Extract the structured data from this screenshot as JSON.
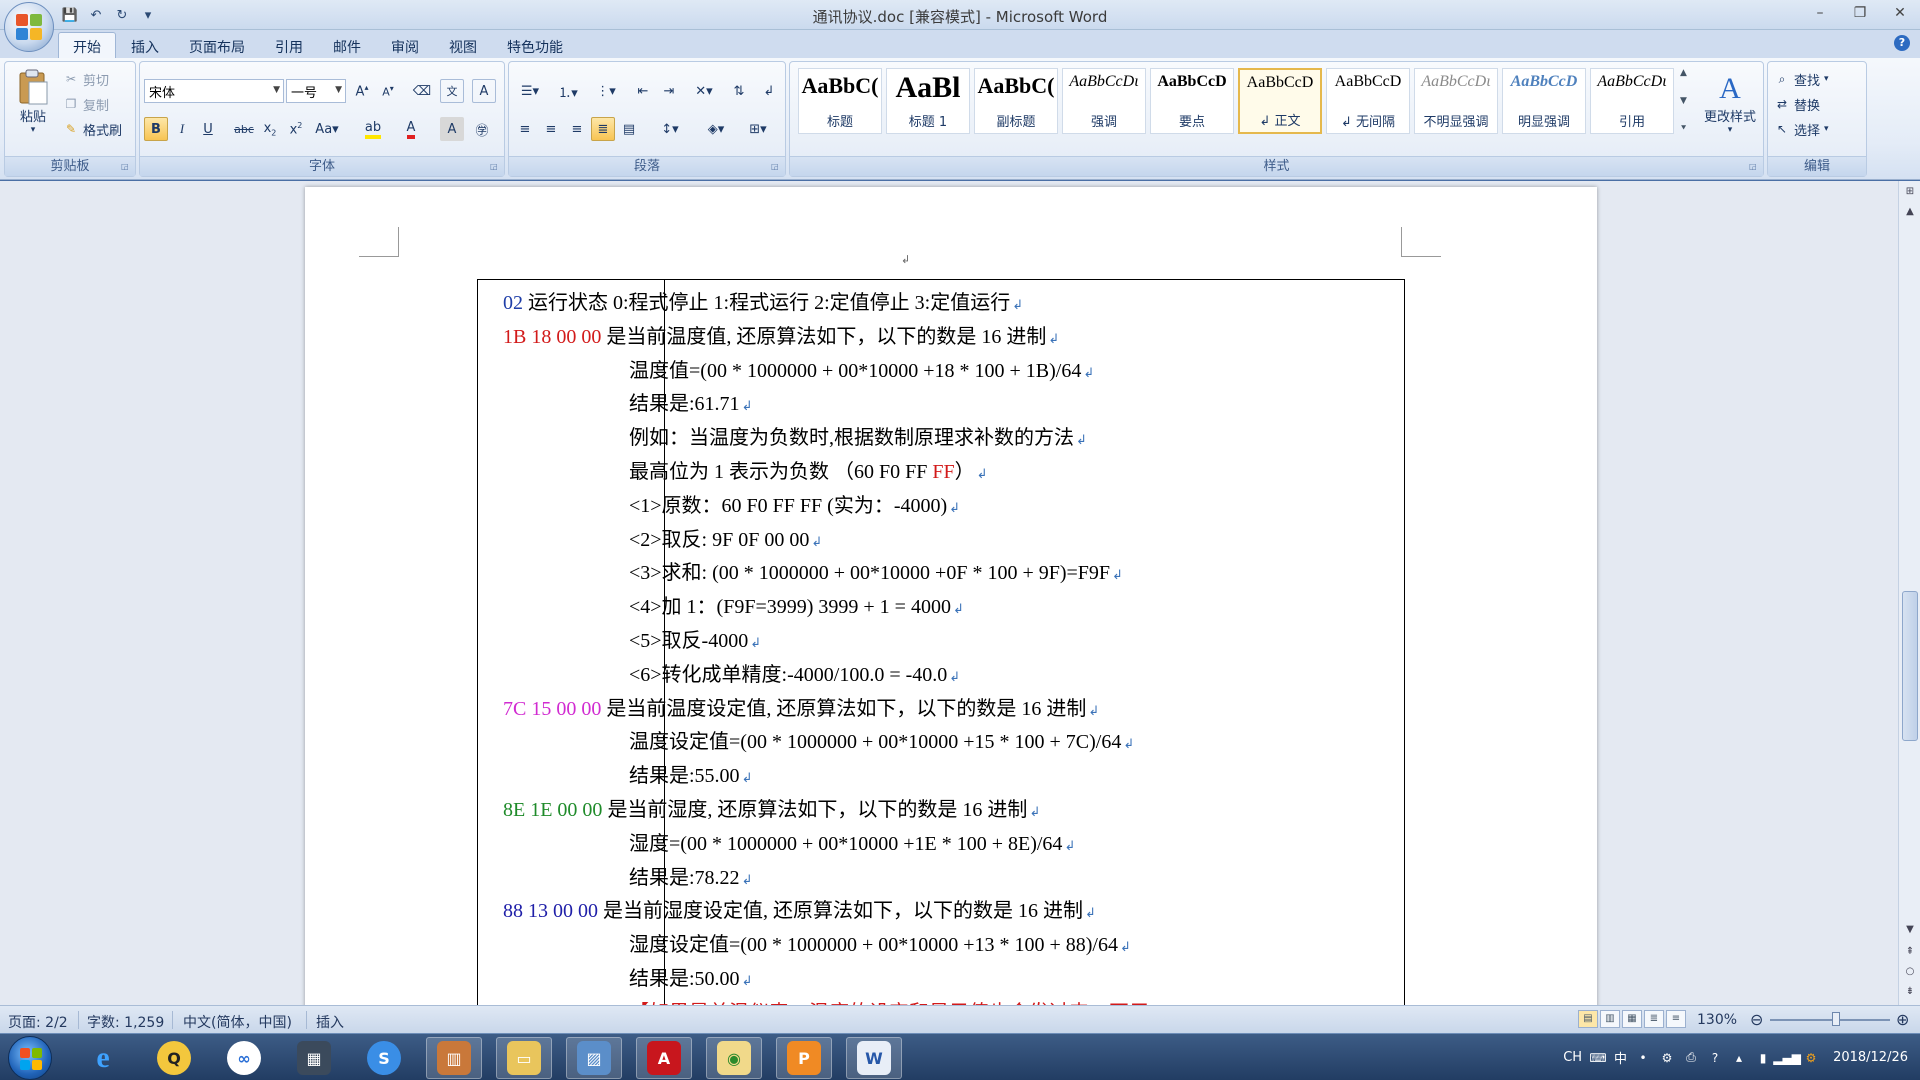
{
  "window": {
    "title": "通讯协议.doc [兼容模式] - Microsoft Word",
    "minimize": "–",
    "restore": "❐",
    "close": "✕"
  },
  "qat": {
    "save": "💾",
    "undo": "↶",
    "redo": "↻",
    "more": "▾"
  },
  "tabs": [
    "开始",
    "插入",
    "页面布局",
    "引用",
    "邮件",
    "审阅",
    "视图",
    "特色功能"
  ],
  "ribbon": {
    "clipboard": {
      "label": "剪贴板",
      "paste": "粘贴",
      "cut": "剪切",
      "copy": "复制",
      "format_painter": "格式刷"
    },
    "font": {
      "label": "字体",
      "font_name": "宋体",
      "font_size": "一号"
    },
    "paragraph": {
      "label": "段落"
    },
    "styles": {
      "label": "样式",
      "items": [
        {
          "sample": "AaBbC(",
          "name": "标题"
        },
        {
          "sample": "AaBl",
          "name": "标题 1"
        },
        {
          "sample": "AaBbC(",
          "name": "副标题"
        },
        {
          "sample": "AaBbCcDι",
          "name": "强调"
        },
        {
          "sample": "AaBbCcD",
          "name": "要点"
        },
        {
          "sample": "AaBbCcD",
          "name": "↲ 正文"
        },
        {
          "sample": "AaBbCcD",
          "name": "↲ 无间隔"
        },
        {
          "sample": "AaBbCcDι",
          "name": "不明显强调"
        },
        {
          "sample": "AaBbCcD",
          "name": "明显强调"
        },
        {
          "sample": "AaBbCcDι",
          "name": "引用"
        }
      ],
      "change_styles": "更改样式"
    },
    "editing": {
      "label": "编辑",
      "find": "查找",
      "replace": "替换",
      "select": "选择"
    }
  },
  "doc": {
    "lines": [
      {
        "parts": [
          {
            "t": "02 ",
            "c": "c-blue"
          },
          {
            "t": "运行状态 0:程式停止 1:程式运行 2:定值停止 3:定值运行"
          }
        ],
        "sub": false
      },
      {
        "parts": [
          {
            "t": "1B 18 00 00",
            "c": "c-red"
          },
          {
            "t": "  是当前温度值, 还原算法如下，以下的数是 16 进制"
          }
        ],
        "sub": false
      },
      {
        "parts": [
          {
            "t": "温度值=(00 * 1000000 + 00*10000 +18 * 100 + 1B)/64"
          }
        ],
        "sub": true
      },
      {
        "parts": [
          {
            "t": "结果是:61.71"
          }
        ],
        "sub": true
      },
      {
        "parts": [
          {
            "t": "例如：当温度为负数时,根据数制原理求补数的方法"
          }
        ],
        "sub": true
      },
      {
        "parts": [
          {
            "t": "最高位为 1 表示为负数 （60 F0 FF "
          },
          {
            "t": "FF",
            "c": "c-red"
          },
          {
            "t": "）"
          }
        ],
        "sub": true
      },
      {
        "parts": [
          {
            "t": "<1>原数：60 F0 FF FF        (实为：-4000)"
          }
        ],
        "sub": true
      },
      {
        "parts": [
          {
            "t": "<2>取反: 9F 0F 00 00"
          }
        ],
        "sub": true
      },
      {
        "parts": [
          {
            "t": "<3>求和: (00 * 1000000 + 00*10000 +0F * 100 + 9F)=F9F"
          }
        ],
        "sub": true
      },
      {
        "parts": [
          {
            "t": "<4>加 1：(F9F=3999)   3999 + 1 = 4000"
          }
        ],
        "sub": true
      },
      {
        "parts": [
          {
            "t": "<5>取反-4000"
          }
        ],
        "sub": true
      },
      {
        "parts": [
          {
            "t": "<6>转化成单精度:-4000/100.0   = -40.0"
          }
        ],
        "sub": true
      },
      {
        "parts": [
          {
            "t": "7C 15 00 00",
            "c": "c-mag"
          },
          {
            "t": "  是当前温度设定值, 还原算法如下，以下的数是 16 进制"
          }
        ],
        "sub": false
      },
      {
        "parts": [
          {
            "t": "温度设定值=(00 * 1000000 + 00*10000 +15 * 100 + 7C)/64"
          }
        ],
        "sub": true
      },
      {
        "parts": [
          {
            "t": "结果是:55.00"
          }
        ],
        "sub": true
      },
      {
        "parts": [
          {
            "t": "8E 1E 00 00",
            "c": "c-green"
          },
          {
            "t": "  是当前湿度, 还原算法如下，以下的数是 16 进制"
          }
        ],
        "sub": false
      },
      {
        "parts": [
          {
            "t": "湿度=(00 * 1000000 + 00*10000 +1E * 100 + 8E)/64"
          }
        ],
        "sub": true
      },
      {
        "parts": [
          {
            "t": "结果是:78.22"
          }
        ],
        "sub": true
      },
      {
        "parts": [
          {
            "t": "88 13 00 00",
            "c": "c-navy"
          },
          {
            "t": "  是当前湿度设定值, 还原算法如下，以下的数是 16 进制"
          }
        ],
        "sub": false
      },
      {
        "parts": [
          {
            "t": "湿度设定值=(00 * 1000000 + 00*10000 +13 * 100 + 88)/64"
          }
        ],
        "sub": true
      },
      {
        "parts": [
          {
            "t": "结果是:50.00"
          }
        ],
        "sub": true
      },
      {
        "parts": [
          {
            "t": "【如果是单温仪表，温度的设定和显示值也会发过来，不用",
            "c": "c-red"
          }
        ],
        "sub": true
      }
    ]
  },
  "status": {
    "page": "页面: 2/2",
    "words": "字数: 1,259",
    "language": "中文(简体，中国)",
    "mode": "插入",
    "zoom": "130%"
  },
  "taskbar": {
    "tray_lang": "CH",
    "tray_ime": "中",
    "date": "2018/12/26"
  }
}
